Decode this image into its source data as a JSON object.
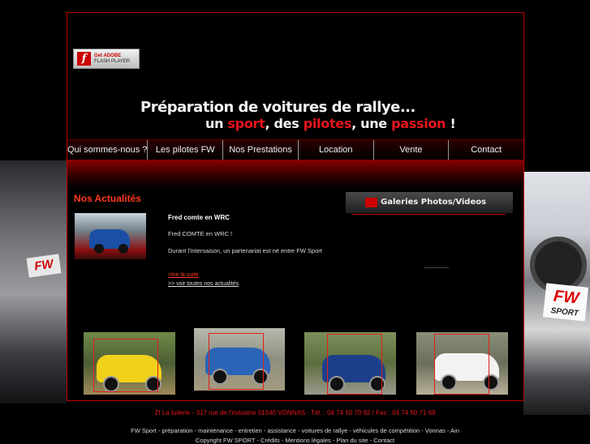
{
  "flash_badge": {
    "line1": "Get ADOBE",
    "line2": "FLASH PLAYER"
  },
  "header": {
    "tagline_line1": "Préparation de voitures de rallye...",
    "tagline_line2": [
      {
        "text": "un ",
        "accent": false
      },
      {
        "text": "sport",
        "accent": true
      },
      {
        "text": ", des ",
        "accent": false
      },
      {
        "text": "pilotes",
        "accent": true
      },
      {
        "text": ", une ",
        "accent": false
      },
      {
        "text": "passion",
        "accent": true
      },
      {
        "text": " !",
        "accent": false
      }
    ]
  },
  "nav": [
    "Qui sommes-nous ?",
    "Les pilotes FW",
    "Nos Prestations",
    "Location",
    "Vente",
    "Contact"
  ],
  "news": {
    "title": "Nos Actualités",
    "item_title": "Fred comte en WRC",
    "para1": "Fred COMTE en WRC !",
    "para2": "Durant l'intersaison, un partenariat est né entre FW Sport",
    "read_more": ">lire la suite",
    "see_all": ">> voir toutes nos actualités"
  },
  "gallery": {
    "title": "Galeries Photos/Videos"
  },
  "thumbnails": [
    "rally-car-yellow-subaru",
    "rally-car-blue-peugeot",
    "rally-car-blue-peugeot-206",
    "rally-car-white-citroen"
  ],
  "footer": {
    "address": "ZI La tuilerie - 317 rue de l'industrie 01540 VONNAS - Tél. : 04 74 50 70 92 / Fax : 04 74 50 71 69",
    "keywords": "FW Sport - préparation - maintenance - entretien - assistance - voitures de rallye - véhicules de compétition - Vonnas - Ain",
    "copyright": "Copyright FW SPORT - Crédits - Mentions légales - Plan du site - Contact"
  },
  "colors": {
    "accent": "#e8141b",
    "frame": "#bb0000"
  }
}
